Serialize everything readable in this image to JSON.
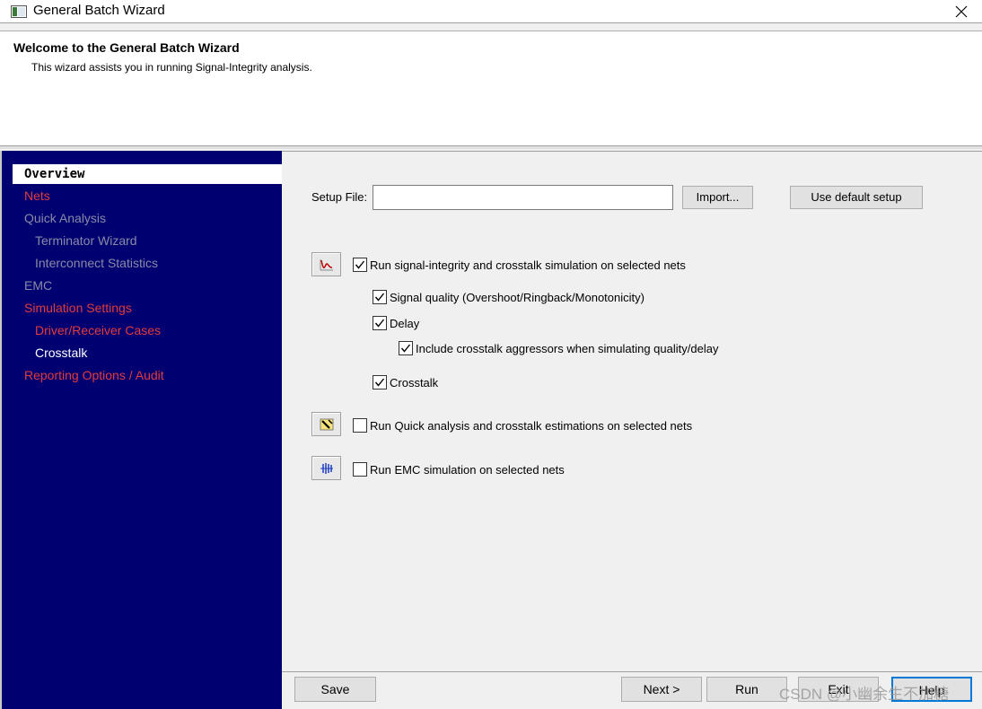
{
  "window": {
    "title": "General Batch Wizard"
  },
  "header": {
    "title": "Welcome to the General Batch Wizard",
    "subtitle": "This wizard assists you in running Signal-Integrity analysis."
  },
  "sidebar": {
    "items": [
      {
        "label": "Overview",
        "state": "selected"
      },
      {
        "label": "Nets",
        "color": "#e03c3c"
      },
      {
        "label": "Quick Analysis",
        "color": "#8a8aa8"
      },
      {
        "label": "Terminator Wizard",
        "color": "#8a8aa8"
      },
      {
        "label": "Interconnect Statistics",
        "color": "#8a8aa8"
      },
      {
        "label": "EMC",
        "color": "#8a8aa8"
      },
      {
        "label": "Simulation Settings",
        "color": "#e03c3c"
      },
      {
        "label": "Driver/Receiver Cases",
        "color": "#e03c3c"
      },
      {
        "label": "Crosstalk",
        "color": "#ffffff"
      },
      {
        "label": "Reporting Options / Audit",
        "color": "#e03c3c"
      }
    ]
  },
  "setup": {
    "label": "Setup File:",
    "value": "",
    "import_button": "Import...",
    "default_button": "Use default setup"
  },
  "options": {
    "si": {
      "label": "Run signal-integrity and crosstalk simulation on selected nets",
      "checked": true,
      "icon": "waveform-icon"
    },
    "signal_quality": {
      "label": "Signal quality (Overshoot/Ringback/Monotonicity)",
      "checked": true
    },
    "delay": {
      "label": "Delay",
      "checked": true
    },
    "include_crosstalk": {
      "label": "Include crosstalk aggressors when simulating quality/delay",
      "checked": true
    },
    "crosstalk": {
      "label": "Crosstalk",
      "checked": true
    },
    "quick": {
      "label": "Run Quick analysis and crosstalk estimations on selected nets",
      "checked": false,
      "icon": "quick-analysis-icon"
    },
    "emc": {
      "label": "Run EMC simulation on selected nets",
      "checked": false,
      "icon": "emc-icon"
    }
  },
  "buttons": {
    "save": "Save",
    "next": "Next >",
    "run": "Run",
    "exit": "Exit",
    "help": "Help"
  },
  "watermark": "CSDN @小幽余生不加糖",
  "colors": {
    "sidebar_bg": "#000070",
    "nav_active": "#e03c3c",
    "nav_disabled": "#8a8aa8"
  }
}
